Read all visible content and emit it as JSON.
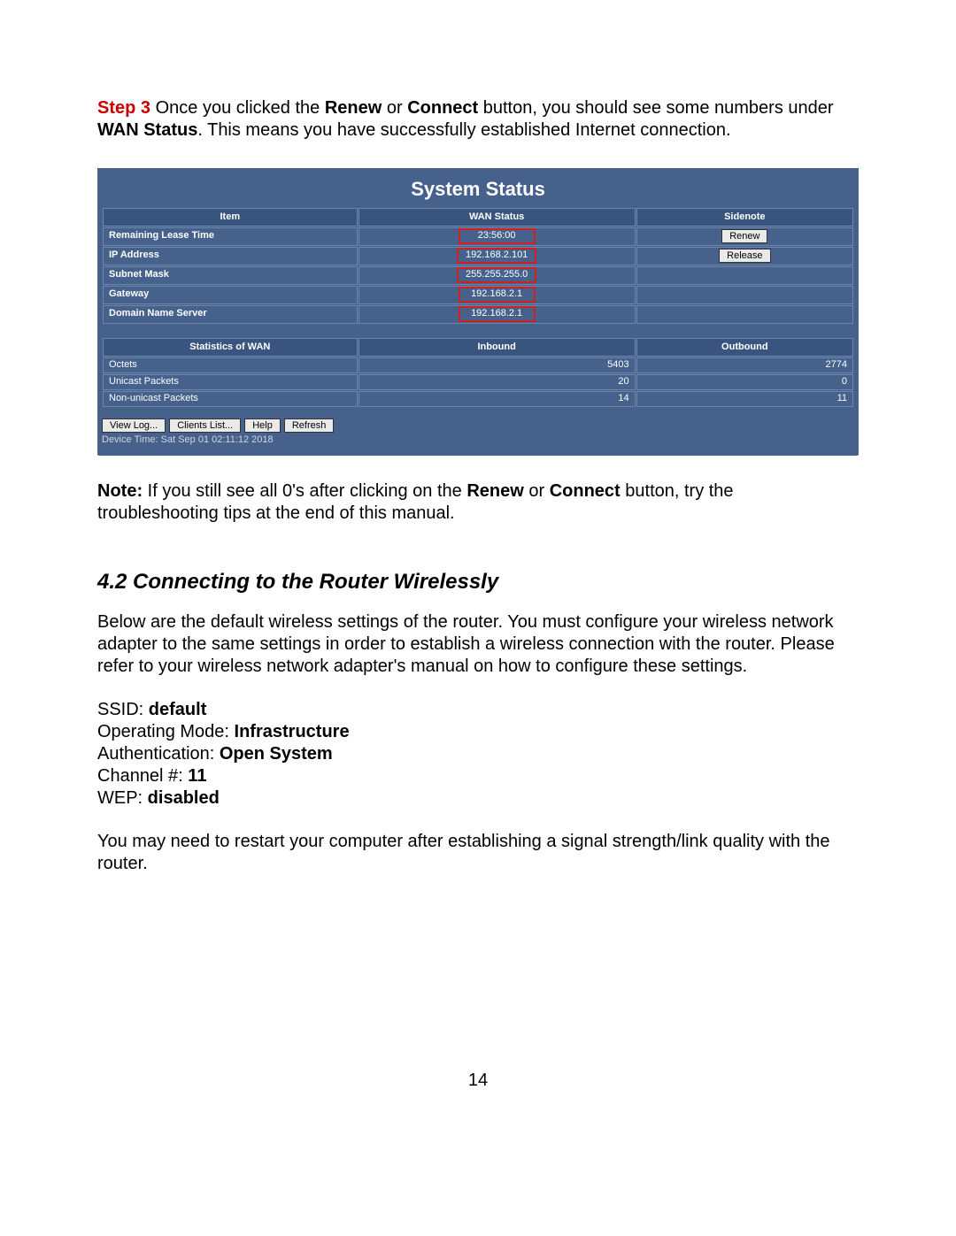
{
  "step3": {
    "step_label": "Step 3",
    "text_a": " Once you clicked the ",
    "renew_word": "Renew",
    "or_word": " or ",
    "connect_word": "Connect",
    "text_b": " button, you should see some numbers under ",
    "wan_status_word": "WAN Status",
    "text_c": ". This means you have successfully established Internet connection."
  },
  "panel": {
    "title": "System Status",
    "headers": {
      "item": "Item",
      "wan_status": "WAN Status",
      "sidenote": "Sidenote"
    },
    "rows": {
      "lease": {
        "label": "Remaining Lease Time",
        "value": "23:56:00",
        "button": "Renew"
      },
      "ip": {
        "label": "IP Address",
        "value": "192.168.2.101",
        "button": "Release"
      },
      "mask": {
        "label": "Subnet Mask",
        "value": "255.255.255.0"
      },
      "gateway": {
        "label": "Gateway",
        "value": "192.168.2.1"
      },
      "dns": {
        "label": "Domain Name Server",
        "value": "192.168.2.1"
      }
    },
    "stats": {
      "headers": {
        "label": "Statistics of WAN",
        "inbound": "Inbound",
        "outbound": "Outbound"
      },
      "octets": {
        "label": "Octets",
        "in": "5403",
        "out": "2774"
      },
      "unicast": {
        "label": "Unicast Packets",
        "in": "20",
        "out": "0"
      },
      "nonunicast": {
        "label": "Non-unicast Packets",
        "in": "14",
        "out": "11"
      }
    },
    "buttons": {
      "view_log": "View Log...",
      "clients_list": "Clients List...",
      "help": "Help",
      "refresh": "Refresh"
    },
    "device_time": "Device Time: Sat Sep 01 02:11:12 2018"
  },
  "note": {
    "note_label": "Note:",
    "text_a": " If you still see all 0's after clicking on the ",
    "renew_word": "Renew",
    "or_word": " or ",
    "connect_word": "Connect",
    "text_b": " button, try the troubleshooting tips at the end of this manual."
  },
  "section_heading": "4.2 Connecting to the Router Wirelessly",
  "wireless_intro": "Below are the default wireless settings of the router. You must configure your wireless network adapter to the same settings in order to establish a wireless connection with the router. Please refer to your wireless network adapter's manual on how to configure these settings.",
  "wireless": {
    "ssid_label": "SSID: ",
    "ssid_value": "default",
    "mode_label": "Operating Mode: ",
    "mode_value": "Infrastructure",
    "auth_label": "Authentication: ",
    "auth_value": "Open System",
    "channel_label": "Channel #: ",
    "channel_value": "11",
    "wep_label": "WEP: ",
    "wep_value": "disabled"
  },
  "restart_note": "You may need to restart your computer after establishing a signal strength/link quality with the router.",
  "page_number": "14"
}
